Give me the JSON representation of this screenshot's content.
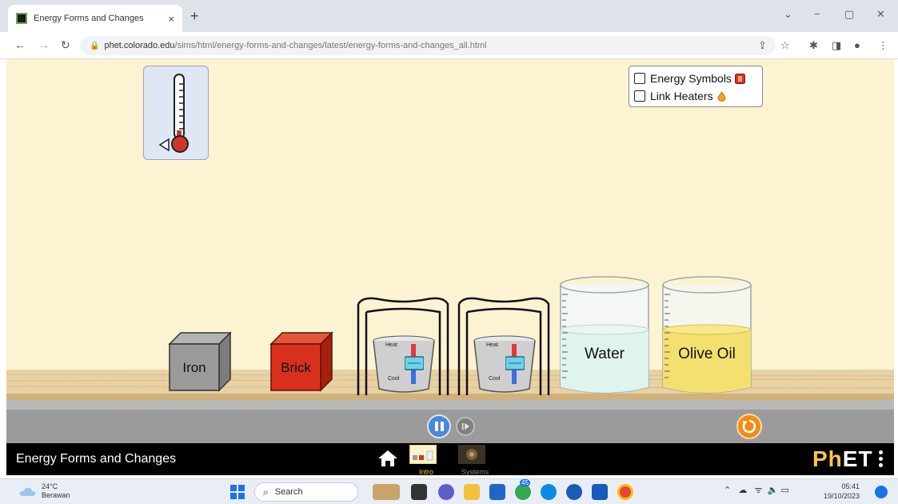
{
  "browser": {
    "tab_title": "Energy Forms and Changes",
    "tab_close": "×",
    "new_tab": "+",
    "url_domain": "phet.colorado.edu",
    "url_path": "/sims/html/energy-forms-and-changes/latest/energy-forms-and-changes_all.html",
    "window_controls": [
      "⌄",
      "−",
      "▢",
      "✕"
    ]
  },
  "sim": {
    "options": [
      {
        "label": "Energy Symbols",
        "checked": false
      },
      {
        "label": "Link Heaters",
        "checked": false
      }
    ],
    "blocks": [
      {
        "label": "Iron",
        "color": "#9a9a9a"
      },
      {
        "label": "Brick",
        "color": "#d8301c"
      }
    ],
    "heaters": [
      {
        "heat_label": "Heat",
        "cool_label": "Cool"
      },
      {
        "heat_label": "Heat",
        "cool_label": "Cool"
      }
    ],
    "beakers": [
      {
        "label": "Water",
        "liquid_color": "#dff3ef"
      },
      {
        "label": "Olive Oil",
        "liquid_color": "#f3e06e"
      }
    ]
  },
  "navbar": {
    "title": "Energy Forms and Changes",
    "screens": [
      {
        "label": "Intro",
        "selected": true
      },
      {
        "label": "Systems",
        "selected": false
      }
    ],
    "logo_ph": "Ph",
    "logo_et": "ET"
  },
  "taskbar": {
    "weather_temp": "24°C",
    "weather_desc": "Berawan",
    "search_placeholder": "Search",
    "chrome_badge": "45",
    "time": "05:41",
    "date": "19/10/2023"
  },
  "colors": {
    "sim_background": "#fbf3d2",
    "control_bar": "#9b9b9b",
    "navbar": "#000000",
    "phet_accent": "#f6c744"
  }
}
